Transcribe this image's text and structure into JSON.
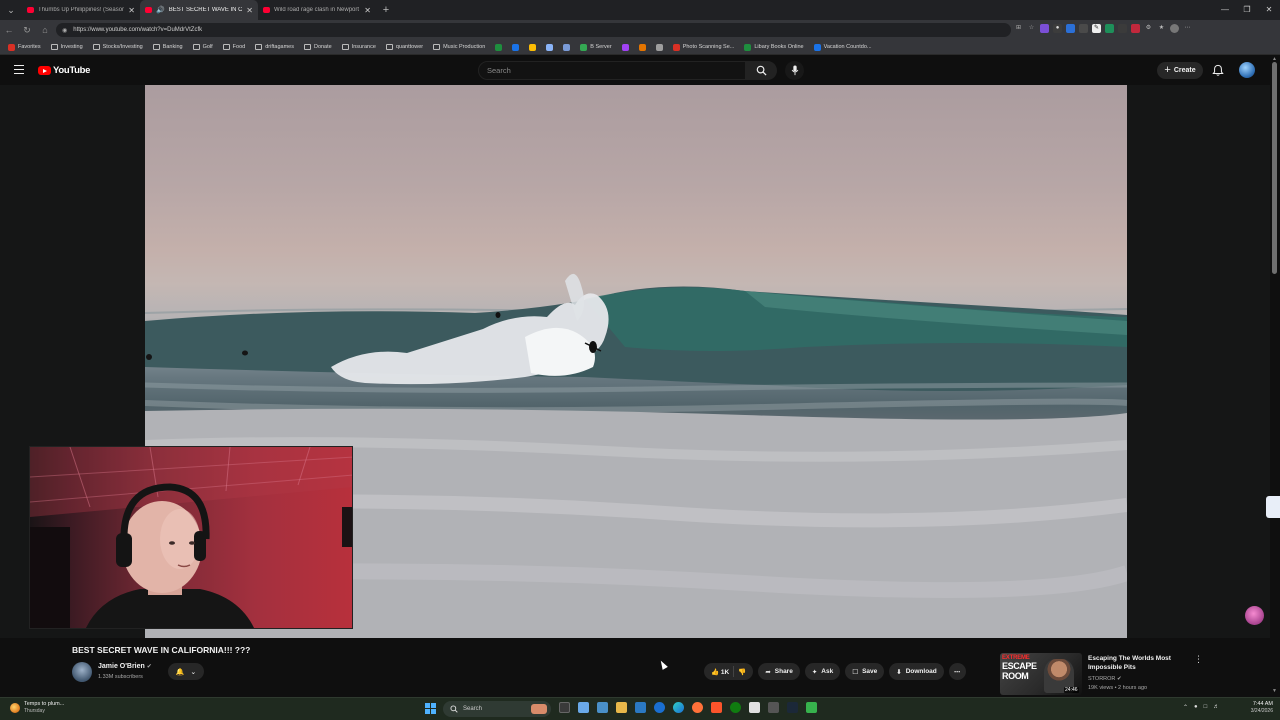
{
  "browser": {
    "tabs": [
      {
        "title": "Thumbs Up Philippines! (Season...",
        "active": false
      },
      {
        "title": "BEST SECRET WAVE IN CALIF...",
        "active": true
      },
      {
        "title": "Wild road rage clash in Newport B...",
        "active": false
      }
    ],
    "url": "https://www.youtube.com/watch?v=DuMdrVtZcfk",
    "bookmarks": [
      {
        "label": "Favorites",
        "icon": "star-icon"
      },
      {
        "label": "Investing",
        "icon": "folder-icon"
      },
      {
        "label": "Stocks/Investing",
        "icon": "folder-icon"
      },
      {
        "label": "Banking",
        "icon": "folder-icon"
      },
      {
        "label": "Golf",
        "icon": "folder-icon"
      },
      {
        "label": "Food",
        "icon": "folder-icon"
      },
      {
        "label": "driftagames",
        "icon": "folder-icon"
      },
      {
        "label": "Donate",
        "icon": "folder-icon"
      },
      {
        "label": "Insurance",
        "icon": "folder-icon"
      },
      {
        "label": "quanttower",
        "icon": "folder-icon"
      },
      {
        "label": "Music Production",
        "icon": "folder-icon"
      },
      {
        "label": "",
        "icon": "gmail-icon"
      },
      {
        "label": "",
        "icon": "phone-icon"
      },
      {
        "label": "",
        "icon": "calendar-icon"
      },
      {
        "label": "",
        "icon": "note-icon"
      },
      {
        "label": "",
        "icon": "app-icon"
      },
      {
        "label": "B Server",
        "icon": "server-icon"
      },
      {
        "label": "",
        "icon": "u-icon"
      },
      {
        "label": "",
        "icon": "plugin-icon"
      },
      {
        "label": "",
        "icon": "bar-icon"
      },
      {
        "label": "Photo Scanning Se...",
        "icon": "scan-icon"
      },
      {
        "label": "Libary Books Online",
        "icon": "book-icon"
      },
      {
        "label": "Vacation Countdo...",
        "icon": "clock-icon"
      }
    ]
  },
  "youtube": {
    "logo_text": "YouTube",
    "search_placeholder": "Search",
    "create_label": "Create"
  },
  "video": {
    "title": "BEST SECRET WAVE IN CALIFORNIA!!! ???",
    "channel_name": "Jamie O'Brien",
    "subscribers": "1.33M subscribers",
    "like_count": "1K",
    "share_label": "Share",
    "ask_label": "Ask",
    "save_label": "Save",
    "download_label": "Download"
  },
  "recommendation": {
    "thumb_line1": "EXTREME",
    "thumb_line2": "ESCAPE",
    "thumb_line3": "ROOM",
    "duration": "24:46",
    "title": "Escaping The Worlds Most Impossible Pits",
    "channel": "STORROR",
    "meta": "19K views • 2 hours ago"
  },
  "taskbar": {
    "weather_line1": "Temps to plum...",
    "weather_line2": "Thursday",
    "search_label": "Search",
    "time": "7:44 AM",
    "date": "3/24/2026"
  },
  "colors": {
    "brand_red": "#ff0000",
    "page_bg": "#0f0f0f",
    "pill_bg": "#272727",
    "link_blue": "#3ea6ff"
  }
}
